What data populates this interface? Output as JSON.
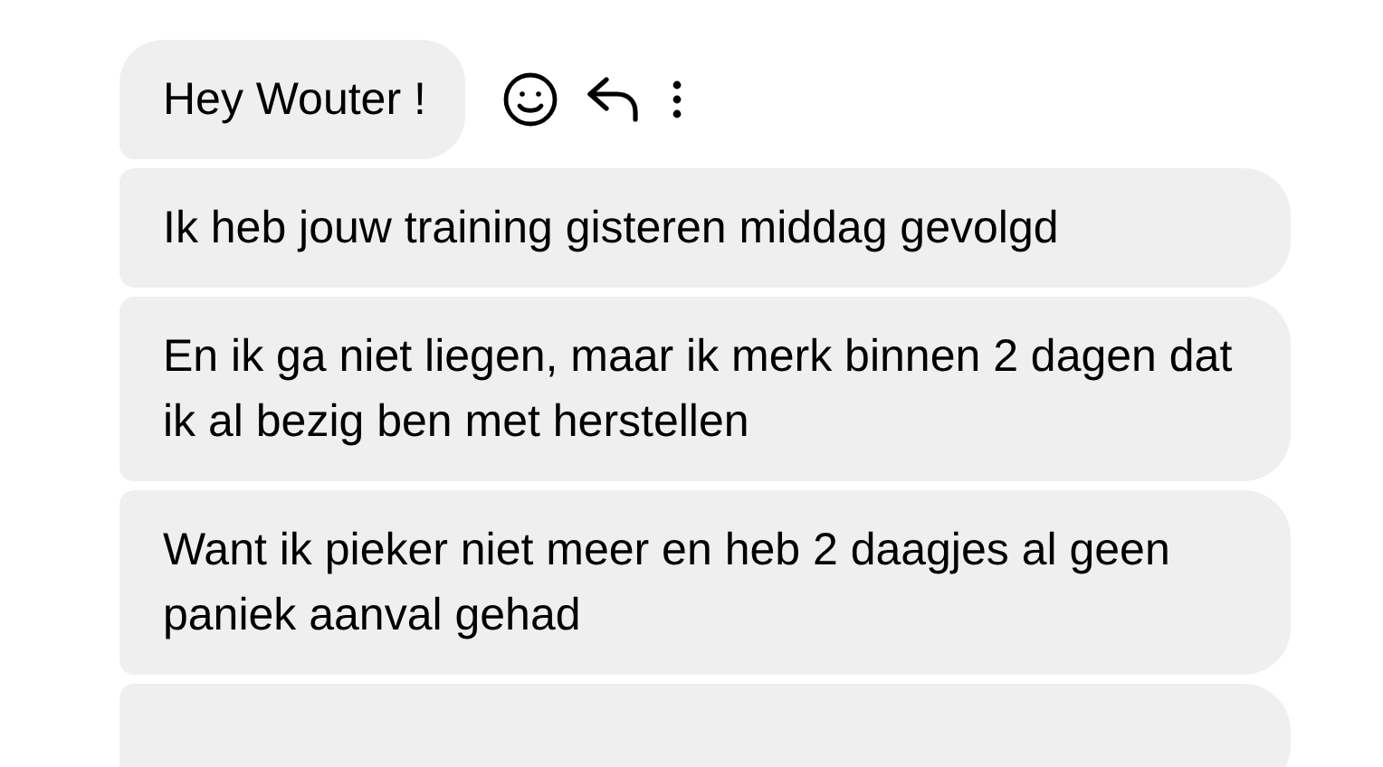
{
  "messages": [
    {
      "kind": "text",
      "text": "Hey Wouter !"
    },
    {
      "kind": "text",
      "text": "Ik heb jouw training gisteren middag gevolgd"
    },
    {
      "kind": "text",
      "text": "En ik ga niet liegen, maar ik merk binnen 2 dagen dat ik al bezig ben met herstellen"
    },
    {
      "kind": "text",
      "text": "Want ik pieker niet meer en heb 2 daagjes al geen paniek aanval gehad"
    },
    {
      "kind": "cut"
    }
  ]
}
